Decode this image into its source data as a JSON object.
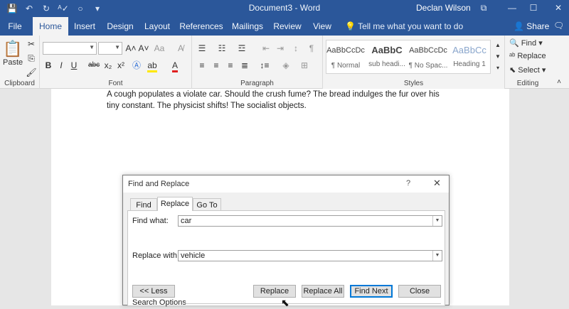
{
  "window": {
    "title": "Document3 - Word",
    "user": "Declan Wilson",
    "controls": {
      "restore": "⧉",
      "minimize": "—",
      "maximize": "☐",
      "close": "✕"
    }
  },
  "qat": {
    "save_icon": "save-icon",
    "undo_icon": "undo-icon",
    "redo_icon": "redo-icon",
    "spellcheck_icon": "spellcheck-icon",
    "touch_icon": "touch-mode-icon",
    "customize_icon": "customize-qat-icon"
  },
  "tabs": [
    {
      "label": "File"
    },
    {
      "label": "Home",
      "active": true
    },
    {
      "label": "Insert"
    },
    {
      "label": "Design"
    },
    {
      "label": "Layout"
    },
    {
      "label": "References"
    },
    {
      "label": "Mailings"
    },
    {
      "label": "Review"
    },
    {
      "label": "View"
    }
  ],
  "tell_me": "Tell me what you want to do",
  "share": "Share",
  "ribbon": {
    "clipboard": {
      "label": "Clipboard",
      "paste": "Paste"
    },
    "font": {
      "label": "Font",
      "font_name": "",
      "font_size": ""
    },
    "paragraph": {
      "label": "Paragraph"
    },
    "styles": {
      "label": "Styles",
      "items": [
        {
          "sample": "AaBbCcDc",
          "name": "¶ Normal"
        },
        {
          "sample": "AaBbC",
          "name": "sub headi..."
        },
        {
          "sample": "AaBbCcDc",
          "name": "¶ No Spac..."
        },
        {
          "sample": "AaBbCc",
          "name": "Heading 1"
        }
      ]
    },
    "editing": {
      "label": "Editing",
      "find": "Find",
      "replace": "Replace",
      "select": "Select"
    }
  },
  "document": {
    "text": "A cough populates a violate car. Should the crush fume? The bread indulges the fur over his tiny constant. The physicist shifts! The socialist objects."
  },
  "dialog": {
    "title": "Find and Replace",
    "help": "?",
    "close": "✕",
    "tabs": [
      "Find",
      "Replace",
      "Go To"
    ],
    "active_tab": "Replace",
    "find_label": "Find what:",
    "find_value": "car",
    "replace_label": "Replace with:",
    "replace_value": "vehicle",
    "buttons": {
      "less": "<< Less",
      "replace": "Replace",
      "replace_all": "Replace All",
      "find_next": "Find Next",
      "close": "Close"
    },
    "search_options": "Search Options"
  },
  "colors": {
    "brand": "#2b579a",
    "ribbon_bg": "#f3f3f3",
    "doc_bg": "#ffffff",
    "focus": "#0078d7"
  }
}
